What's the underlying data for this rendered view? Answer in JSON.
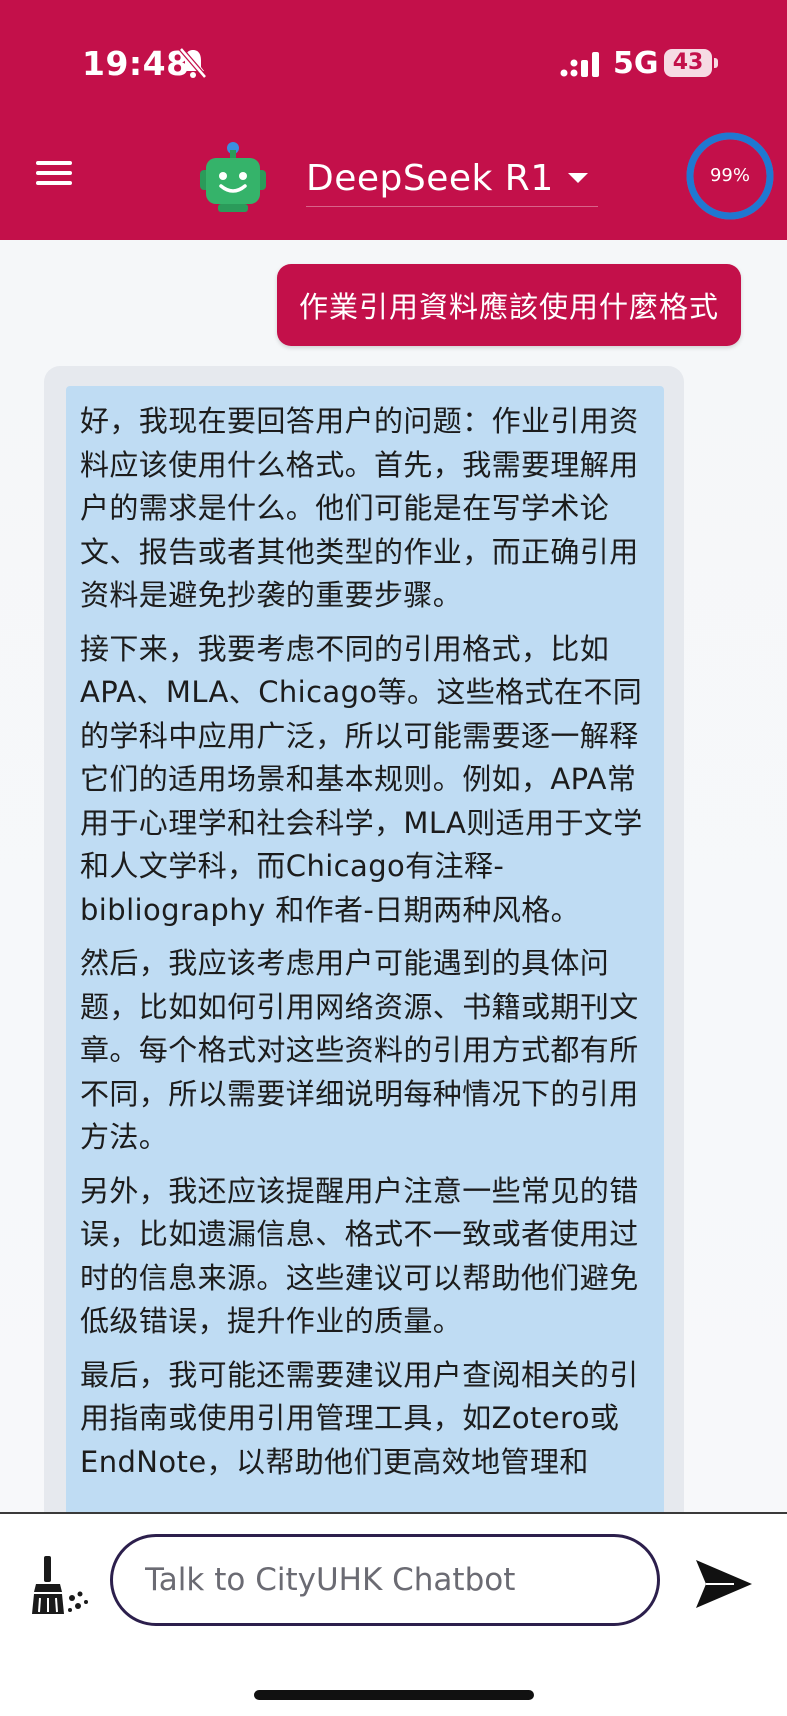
{
  "status_bar": {
    "time": "19:48",
    "network": "5G",
    "battery": "43"
  },
  "header": {
    "model_name": "DeepSeek R1",
    "progress_label": "99%",
    "progress_value": 0.99,
    "brand_color": "#c3104a",
    "ring_color": "#1f78d1"
  },
  "chat": {
    "user_message": "作業引用資料應該使用什麼格式",
    "thinking_paragraphs": [
      "好，我现在要回答用户的问题：作业引用资料应该使用什么格式。首先，我需要理解用户的需求是什么。他们可能是在写学术论文、报告或者其他类型的作业，而正确引用资料是避免抄袭的重要步骤。",
      "接下来，我要考虑不同的引用格式，比如APA、MLA、Chicago等。这些格式在不同的学科中应用广泛，所以可能需要逐一解释它们的适用场景和基本规则。例如，APA常用于心理学和社会科学，MLA则适用于文学和人文学科，而Chicago有注释- bibliography 和作者-日期两种风格。",
      "然后，我应该考虑用户可能遇到的具体问题，比如如何引用网络资源、书籍或期刊文章。每个格式对这些资料的引用方式都有所不同，所以需要详细说明每种情况下的引用方法。",
      "另外，我还应该提醒用户注意一些常见的错误，比如遗漏信息、格式不一致或者使用过时的信息来源。这些建议可以帮助他们避免低级错误，提升作业的质量。",
      "最后，我可能还需要建议用户查阅相关的引用指南或使用引用管理工具，如Zotero或EndNote，以帮助他们更高效地管理和"
    ]
  },
  "composer": {
    "placeholder": "Talk to CityUHK Chatbot",
    "value": ""
  },
  "icons": {
    "menu": "hamburger-menu-icon",
    "logo": "robot-logo-icon",
    "clear": "broom-icon",
    "send": "send-arrow-icon"
  }
}
